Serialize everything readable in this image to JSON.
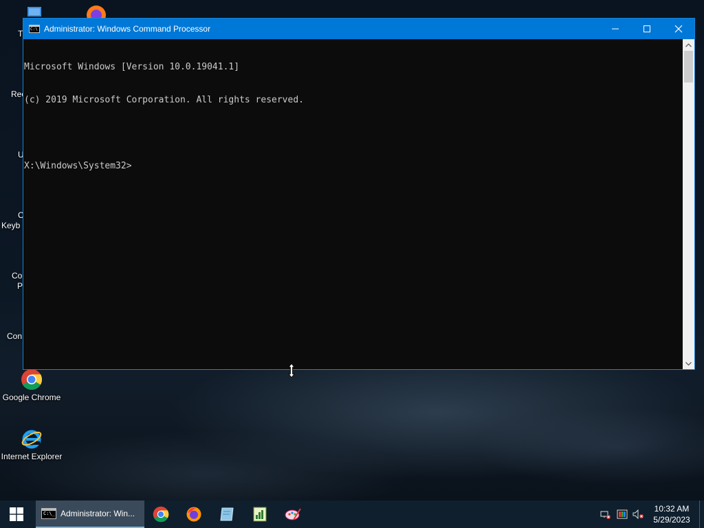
{
  "window": {
    "title": "Administrator: Windows Command Processor",
    "console_lines": [
      "Microsoft Windows [Version 10.0.19041.1]",
      "(c) 2019 Microsoft Corporation. All rights reserved.",
      "",
      "X:\\Windows\\System32>"
    ]
  },
  "desktop": {
    "icons": [
      {
        "label": "Google Chrome",
        "icon": "chrome-icon"
      },
      {
        "label": "Internet Explorer",
        "icon": "internet-explorer-icon"
      }
    ],
    "partial_labels": [
      "T",
      "Rec",
      "U",
      "C",
      "Keyb",
      "Co",
      "P",
      "Con"
    ]
  },
  "taskbar": {
    "active_task_label": "Administrator: Win...",
    "pinned": [
      "chrome-icon",
      "firefox-icon",
      "notebook-icon",
      "notepad-chart-icon",
      "paint-icon"
    ],
    "clock": {
      "time": "10:32 AM",
      "date": "5/29/2023"
    }
  },
  "colors": {
    "titlebar": "#0078d7",
    "console_bg": "#0c0c0c",
    "console_text": "#cccccc",
    "taskbar": "#0f1f2e"
  }
}
